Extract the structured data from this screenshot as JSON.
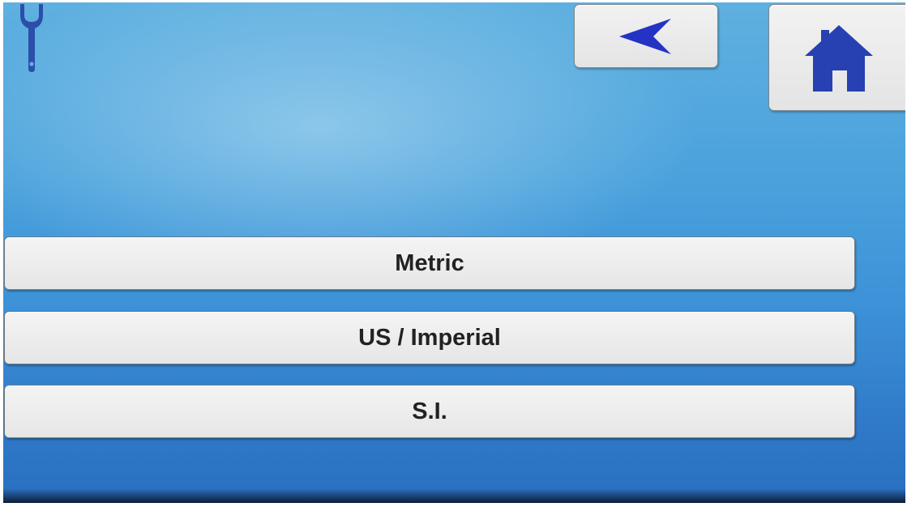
{
  "header": {
    "settings_icon": "wrench-icon",
    "back_icon": "back-arrow-icon",
    "home_icon": "home-icon"
  },
  "unit_options": [
    {
      "label": "Metric"
    },
    {
      "label": "US / Imperial"
    },
    {
      "label": "S.I."
    }
  ],
  "colors": {
    "background_top": "#5fb0e0",
    "background_bottom": "#2a6fc0",
    "icon_blue": "#2a45b8",
    "button_face": "#ececec",
    "button_text": "#222222"
  }
}
